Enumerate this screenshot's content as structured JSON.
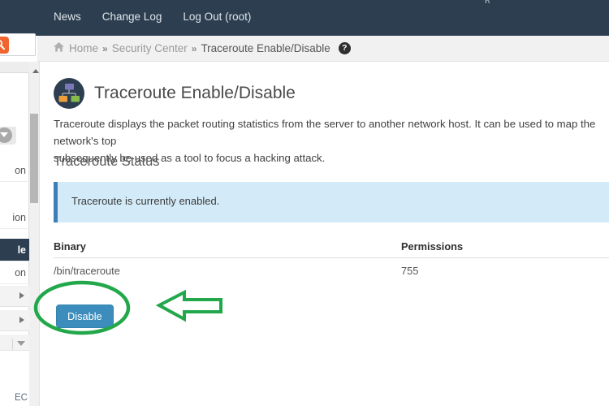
{
  "topbar": {
    "clipped_text": "p",
    "nav": [
      {
        "label": "News"
      },
      {
        "label": "Change Log"
      },
      {
        "label": "Log Out (root)"
      }
    ]
  },
  "search": {
    "placeholder": "",
    "value": "",
    "icon": "search-icon"
  },
  "breadcrumb": {
    "home_icon": "home-icon",
    "items": [
      {
        "label": "Home",
        "current": false
      },
      {
        "label": "Security Center",
        "current": false
      },
      {
        "label": "Traceroute Enable/Disable",
        "current": true
      }
    ],
    "separator": "»",
    "help_icon_label": "?"
  },
  "sidebar": {
    "items": [
      {
        "label": "on",
        "active": false
      },
      {
        "label": "ion",
        "active": false
      },
      {
        "label": "le",
        "active": true
      },
      {
        "label": "on",
        "active": false
      }
    ],
    "groups": [
      {
        "icon": "chevron-right-icon"
      },
      {
        "icon": "chevron-right-icon"
      },
      {
        "icon": "chevron-down-icon"
      }
    ],
    "footer_label": "EC",
    "collapse_icon": "chevron-down-circle-icon"
  },
  "scrollbar": {
    "up_icon": "scroll-up-arrow-icon"
  },
  "page": {
    "icon": "network-topology-icon",
    "title": "Traceroute Enable/Disable",
    "description": "Traceroute displays the packet routing statistics from the server to another network host. It can be used to map the network's top",
    "description_line2": "subsequently be used as a tool to focus a hacking attack."
  },
  "status_section": {
    "heading": "Traceroute Status",
    "alert_text": "Traceroute is currently enabled."
  },
  "table": {
    "columns": [
      "Binary",
      "Permissions"
    ],
    "rows": [
      {
        "binary": "/bin/traceroute",
        "permissions": "755"
      }
    ]
  },
  "actions": {
    "disable_label": "Disable"
  },
  "annotations": {
    "ellipse_color": "#22a84a",
    "arrow_color": "#22a84a",
    "ellipse_target": "disable-button",
    "arrow_direction": "left"
  },
  "colors": {
    "topbar_bg": "#2d3e50",
    "accent_orange": "#f0652f",
    "button_blue": "#3c8dbc",
    "alert_bg": "#d3ebf8",
    "alert_border": "#3b7fb5",
    "annotation_green": "#22a84a"
  }
}
